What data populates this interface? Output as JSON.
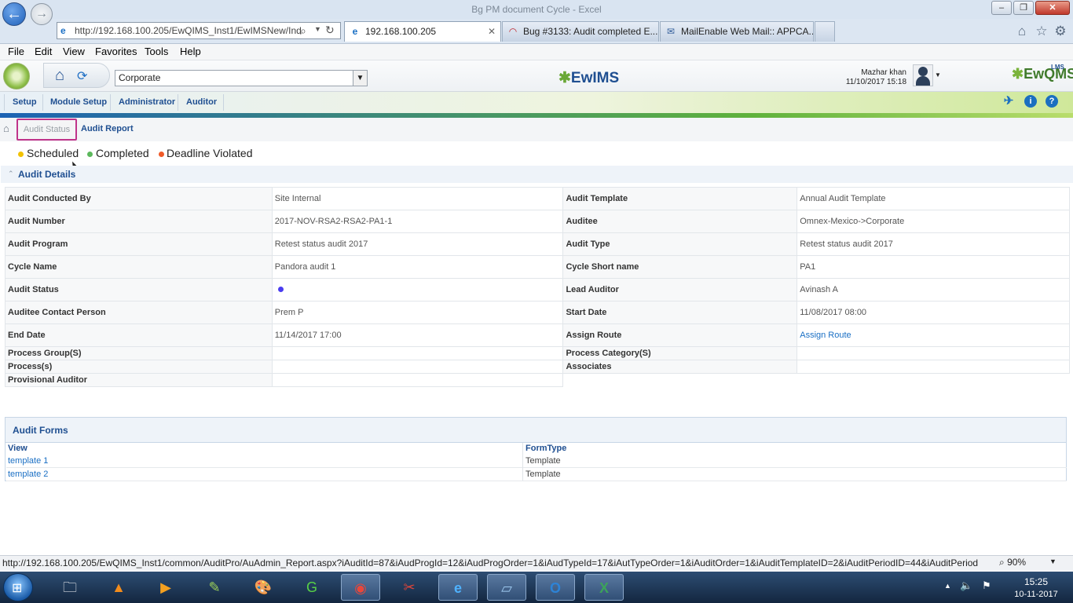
{
  "window": {
    "title": "Bg PM document Cycle - Excel"
  },
  "browser": {
    "address": "http://192.168.100.205/EwQIMS_Inst1/EwIMSNew/Ind",
    "tabs": [
      {
        "label": "192.168.100.205"
      },
      {
        "label": "Bug #3133: Audit completed E..."
      },
      {
        "label": "MailEnable Web Mail:: APPCA..."
      }
    ],
    "menu": [
      "File",
      "Edit",
      "View",
      "Favorites",
      "Tools",
      "Help"
    ],
    "status_url": "http://192.168.100.205/EwQIMS_Inst1/common/AuditPro/AuAdmin_Report.aspx?iAuditId=87&iAudProgId=12&iAudProgOrder=1&iAudTypeId=17&iAutTypeOrder=1&iAuditOrder=1&iAuditTemplateID=2&iAuditPeriodID=44&iAuditPeriod",
    "zoom": "90%"
  },
  "app": {
    "location": "Corporate",
    "brand": "EwIMS",
    "brand_right": "EwQMS",
    "brand_lms": "LMS",
    "user_name": "Mazhar khan",
    "user_time": "11/10/2017 15:18",
    "modules": [
      "Setup",
      "Module Setup",
      "Administrator",
      "Auditor"
    ],
    "subtabs": {
      "status": "Audit Status",
      "report": "Audit Report"
    },
    "legend": [
      {
        "label": "Scheduled",
        "color": "#f2c200"
      },
      {
        "label": "Completed",
        "color": "#5cb85c"
      },
      {
        "label": "Deadline Violated",
        "color": "#f05a28"
      }
    ],
    "details_title": "Audit Details",
    "details": [
      {
        "l1": "Audit Conducted By",
        "v1": "Site Internal",
        "l2": "Audit Template",
        "v2": "Annual Audit Template"
      },
      {
        "l1": "Audit Number",
        "v1": "2017-NOV-RSA2-RSA2-PA1-1",
        "l2": "Auditee",
        "v2": "Omnex-Mexico->Corporate"
      },
      {
        "l1": "Audit Program",
        "v1": "Retest status audit 2017",
        "l2": "Audit Type",
        "v2": "Retest status audit 2017"
      },
      {
        "l1": "Cycle Name",
        "v1": "Pandora audit 1",
        "l2": "Cycle Short name",
        "v2": "PA1"
      },
      {
        "l1": "Audit Status",
        "v1": "",
        "l2": "Lead Auditor",
        "v2": "Avinash A"
      },
      {
        "l1": "Auditee Contact Person",
        "v1": "Prem P",
        "l2": "Start Date",
        "v2": "11/08/2017 08:00"
      },
      {
        "l1": "End Date",
        "v1": "11/14/2017 17:00",
        "l2": "Assign Route",
        "v2": "Assign Route"
      },
      {
        "l1": "Process Group(S)",
        "v1": "",
        "l2": "Process Category(S)",
        "v2": ""
      },
      {
        "l1": "Process(s)",
        "v1": "",
        "l2": "Associates",
        "v2": ""
      },
      {
        "l1": "Provisional Auditor",
        "v1": ""
      }
    ],
    "status_dot_color": "#4a3cf0",
    "forms": {
      "title": "Audit Forms",
      "col_view": "View",
      "col_type": "FormType",
      "rows": [
        {
          "view": "template 1",
          "type": "Template"
        },
        {
          "view": "template 2",
          "type": "Template"
        }
      ]
    }
  },
  "taskbar": {
    "time": "15:25",
    "date": "10-11-2017"
  }
}
